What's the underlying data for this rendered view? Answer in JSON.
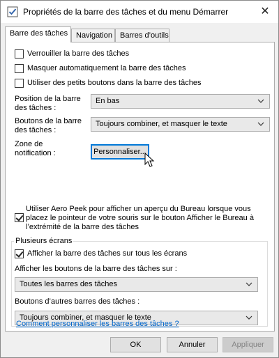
{
  "window": {
    "title": "Propriétés de la barre des tâches et du menu Démarrer",
    "close_glyph": "✕"
  },
  "tabs": [
    {
      "label": "Barre des tâches",
      "active": true
    },
    {
      "label": "Navigation",
      "active": false
    },
    {
      "label": "Barres d’outils",
      "active": false
    }
  ],
  "options": {
    "lock": {
      "label": "Verrouiller la barre des tâches",
      "checked": false
    },
    "autohide": {
      "label": "Masquer automatiquement la barre des tâches",
      "checked": false
    },
    "small_buttons": {
      "label": "Utiliser des petits boutons dans la barre des tâches",
      "checked": false
    }
  },
  "position": {
    "label_line1": "Position de la barre",
    "label_line2": "des tâches :",
    "value": "En bas"
  },
  "buttons_combine": {
    "label_line1": "Boutons de la barre",
    "label_line2": "des tâches :",
    "value": "Toujours combiner, et masquer le texte"
  },
  "notification": {
    "label_line1": "Zone de",
    "label_line2": "notification :",
    "button": "Personnaliser..."
  },
  "aero_peek": {
    "checked": true,
    "line1": "Utiliser Aero Peek pour afficher un aperçu du Bureau lorsque vous",
    "line2": "placez le pointeur de votre souris sur le bouton Afficher le Bureau à",
    "line3": "l’extrémité de la barre des tâches"
  },
  "multi_screen": {
    "legend": "Plusieurs écrans",
    "show_all": {
      "label": "Afficher la barre des tâches sur tous les écrans",
      "checked": true
    },
    "show_buttons_label": "Afficher les boutons de la barre des tâches sur :",
    "show_buttons_value": "Toutes les barres des tâches",
    "other_buttons_label": "Boutons d’autres barres des tâches :",
    "other_buttons_value": "Toujours combiner, et masquer le texte"
  },
  "help_link": "Comment personnaliser les barres des tâches ?",
  "footer": {
    "ok": "OK",
    "cancel": "Annuler",
    "apply": "Appliquer"
  },
  "colors": {
    "accent": "#0078d7",
    "link": "#0066cc",
    "dialog_bg": "#f0f0f0"
  }
}
